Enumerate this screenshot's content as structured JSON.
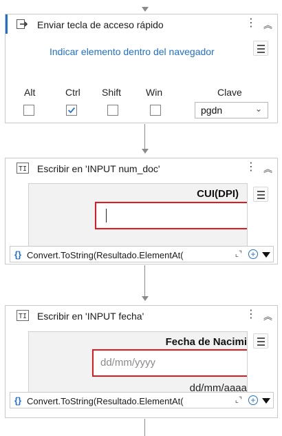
{
  "activities": [
    {
      "title": "Enviar tecla de acceso rápido",
      "indicate_link": "Indicar elemento dentro del navegador",
      "modifiers": [
        {
          "label": "Alt",
          "checked": false
        },
        {
          "label": "Ctrl",
          "checked": true
        },
        {
          "label": "Shift",
          "checked": false
        },
        {
          "label": "Win",
          "checked": false
        }
      ],
      "key_label": "Clave",
      "key_value": "pgdn"
    },
    {
      "title": "Escribir en 'INPUT  num_doc'",
      "preview_label": "CUI(DPI)",
      "expression": "Convert.ToString(Resultado.ElementAt("
    },
    {
      "title": "Escribir en 'INPUT  fecha'",
      "preview_label": "Fecha de Nacimi",
      "preview_placeholder": "dd/mm/yyyy",
      "preview_hint": "dd/mm/aaaa",
      "expression": "Convert.ToString(Resultado.ElementAt("
    }
  ],
  "icons": {
    "hotkey": "send-hotkey-icon",
    "typeinto": "type-into-icon"
  },
  "colors": {
    "accent": "#1f6fd1",
    "highlight": "#e0191f"
  }
}
